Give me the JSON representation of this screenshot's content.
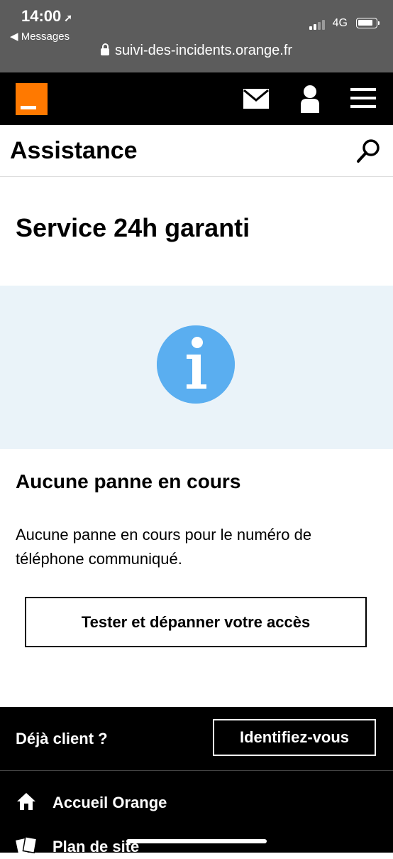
{
  "status_bar": {
    "time": "14:00",
    "back_label": "Messages",
    "network": "4G",
    "url": "suivi-des-incidents.orange.fr"
  },
  "header": {
    "icons": [
      "mail-icon",
      "user-icon",
      "menu-icon"
    ]
  },
  "subheader": {
    "title": "Assistance"
  },
  "main": {
    "title": "Service 24h garanti",
    "status_heading": "Aucune panne en cours",
    "status_text": "Aucune panne en cours pour le numéro de téléphone communiqué.",
    "test_button_label": "Tester et dépanner votre accès"
  },
  "footer": {
    "client_label": "Déjà client ?",
    "login_button_label": "Identifiez-vous",
    "links": [
      {
        "label": "Accueil Orange",
        "icon": "home-icon"
      },
      {
        "label": "Plan de site",
        "icon": "sitemap-icon"
      }
    ]
  },
  "colors": {
    "brand": "#ff7900",
    "info_band": "#eaf3f9",
    "info_icon": "#5aaef0",
    "status_bar": "#5c5c5c"
  }
}
